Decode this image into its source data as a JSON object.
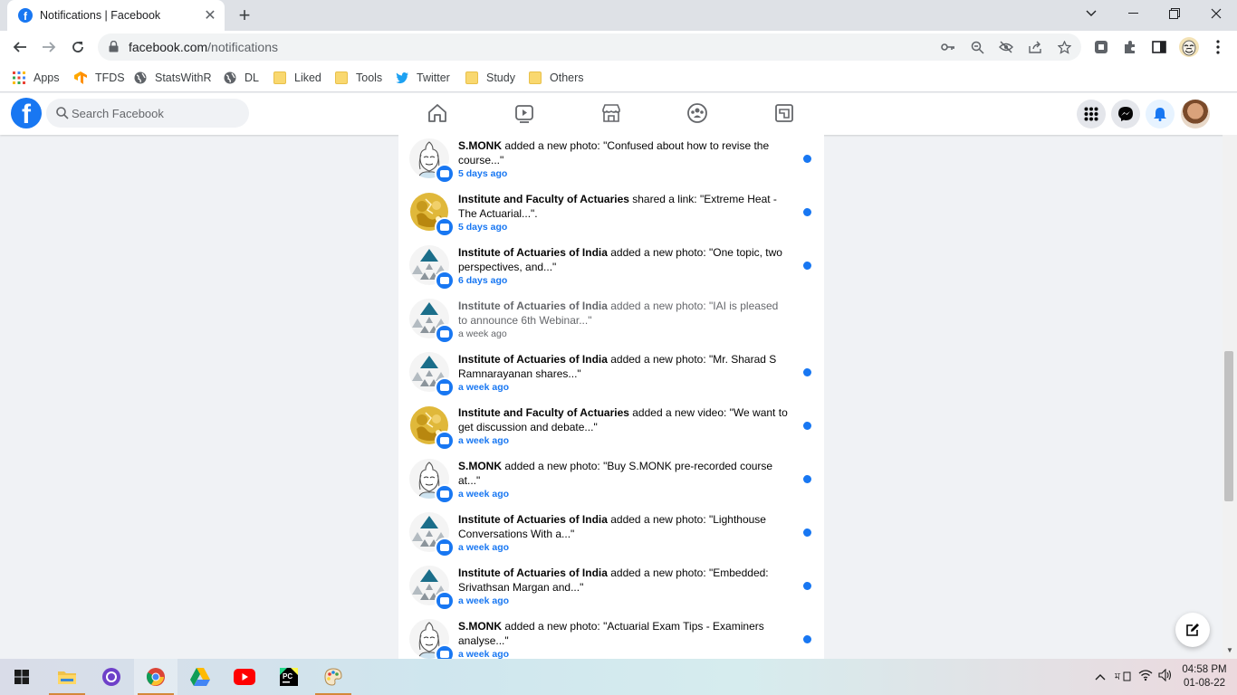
{
  "browser": {
    "tab_title": "Notifications | Facebook",
    "tab_close": "✕",
    "new_tab": "+",
    "url_domain": "facebook.com",
    "url_path": "/notifications"
  },
  "bookmarks": [
    {
      "label": "Apps"
    },
    {
      "label": "TFDS"
    },
    {
      "label": "StatsWithR"
    },
    {
      "label": "DL"
    },
    {
      "label": "Liked"
    },
    {
      "label": "Tools"
    },
    {
      "label": "Twitter"
    },
    {
      "label": "Study"
    },
    {
      "label": "Others"
    }
  ],
  "facebook": {
    "logo": "f",
    "search_placeholder": "Search Facebook",
    "brand_color": "#1877f2"
  },
  "notifications": [
    {
      "actor": "S.MONK",
      "action": " added a new photo: \"Confused about how to revise the course...\"",
      "time": "5 days ago",
      "unread": true,
      "avatar": "monk"
    },
    {
      "actor": "Institute and Faculty of Actuaries",
      "action": " shared a link: \"Extreme Heat - The Actuarial...\".",
      "time": "5 days ago",
      "unread": true,
      "avatar": "ifoa"
    },
    {
      "actor": "Institute of Actuaries of India",
      "action": " added a new photo: \"One topic, two perspectives, and...\"",
      "time": "6 days ago",
      "unread": true,
      "avatar": "iai"
    },
    {
      "actor": "Institute of Actuaries of India",
      "action": " added a new photo: \"IAI is pleased to announce 6th Webinar...\"",
      "time": "a week ago",
      "unread": false,
      "avatar": "iai"
    },
    {
      "actor": "Institute of Actuaries of India",
      "action": " added a new photo: \"Mr. Sharad S Ramnarayanan shares...\"",
      "time": "a week ago",
      "unread": true,
      "avatar": "iai"
    },
    {
      "actor": "Institute and Faculty of Actuaries",
      "action": " added a new video: \"We want to get discussion and debate...\"",
      "time": "a week ago",
      "unread": true,
      "avatar": "ifoa"
    },
    {
      "actor": "S.MONK",
      "action": " added a new photo: \"Buy S.MONK pre-recorded course at...\"",
      "time": "a week ago",
      "unread": true,
      "avatar": "monk"
    },
    {
      "actor": "Institute of Actuaries of India",
      "action": " added a new photo: \"Lighthouse Conversations With a...\"",
      "time": "a week ago",
      "unread": true,
      "avatar": "iai"
    },
    {
      "actor": "Institute of Actuaries of India",
      "action": " added a new photo: \"Embedded: Srivathsan Margan and...\"",
      "time": "a week ago",
      "unread": true,
      "avatar": "iai"
    },
    {
      "actor": "S.MONK",
      "action": " added a new photo: \"Actuarial Exam Tips - Examiners analyse...\"",
      "time": "a week ago",
      "unread": true,
      "avatar": "monk"
    }
  ],
  "taskbar": {
    "time": "04:58 PM",
    "date": "01-08-22"
  }
}
